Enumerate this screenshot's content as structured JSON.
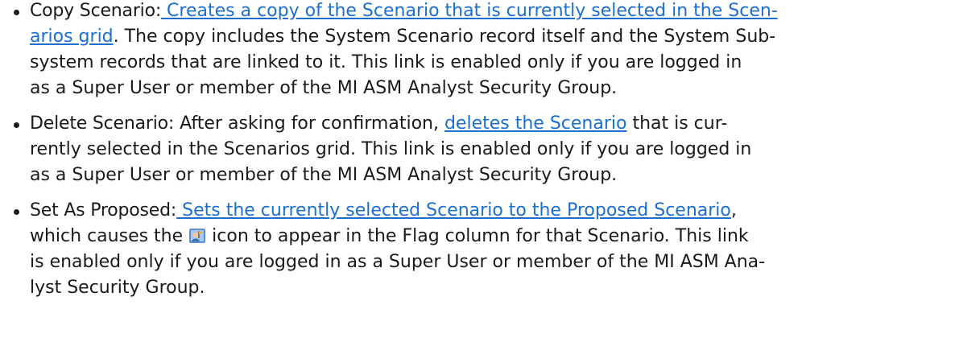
{
  "items": [
    {
      "term": "Copy Scenario:",
      "lines": [
        {
          "link": " Creates a copy of the Scenario that is currently selected in the Scen-"
        },
        {
          "link": "arios grid",
          "text": ". The copy includes the System Scenario record itself and the System Sub-"
        },
        {
          "text": "system records that are linked to it.  This link is enabled only if you are logged in"
        },
        {
          "text": "as a Super User or member of the MI ASM Analyst Security Group."
        }
      ]
    },
    {
      "term": "Delete Scenario:",
      "lines": [
        {
          "text": " After asking for confirmation, ",
          "link": "deletes the Scenario",
          "text2": " that is cur-"
        },
        {
          "text": "rently selected in the ",
          "bold": "Scenarios",
          "text2": " grid.  This link is enabled only if you are logged in"
        },
        {
          "text": "as a Super User or member of the MI ASM Analyst Security Group."
        }
      ]
    },
    {
      "term": "Set As Proposed:",
      "lines": [
        {
          "link": " Sets the currently selected Scenario to the Proposed Scenario",
          "text": ","
        },
        {
          "text": "which causes the ",
          "text2": " icon to appear in the ",
          "bold": "Flag",
          "text3": " column for that Scenario.  This link"
        },
        {
          "text": "is enabled only if you are logged in as a Super User or member of the MI ASM Ana-"
        },
        {
          "text": "lyst Security Group."
        }
      ]
    }
  ],
  "icons": {
    "flag": "proposed-scenario-flag-icon"
  },
  "colors": {
    "link": "#1a6fd1",
    "text": "#1a1a1a"
  }
}
